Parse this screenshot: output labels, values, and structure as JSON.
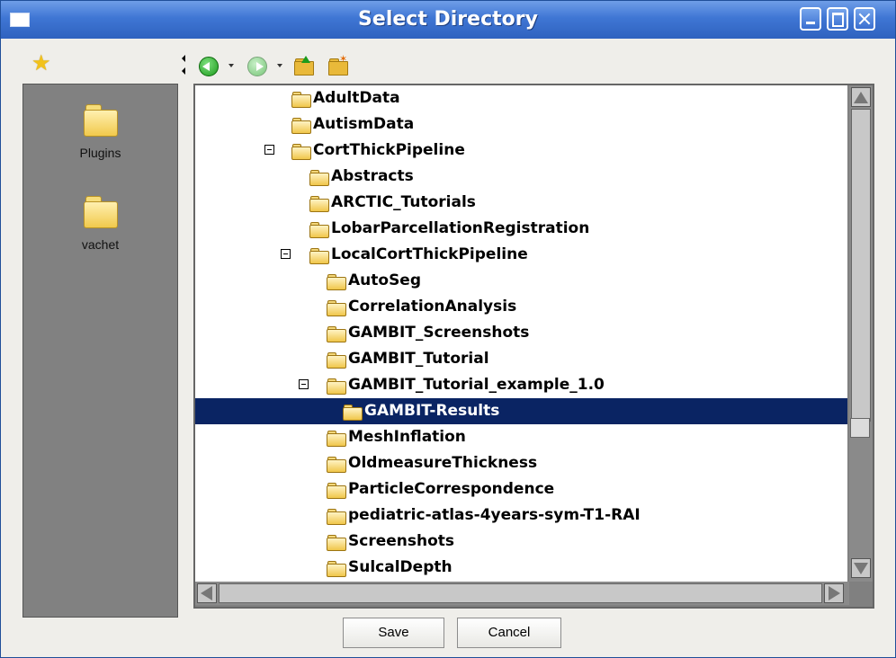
{
  "window": {
    "title": "Select Directory"
  },
  "toolbar": {
    "icons": [
      "star-icon",
      "back-arrow-icon",
      "forward-arrow-icon",
      "folder-up-icon",
      "new-folder-icon"
    ]
  },
  "bookmarks": {
    "items": [
      {
        "label": "Plugins",
        "icon": "folder-icon"
      },
      {
        "label": "vachet",
        "icon": "folder-icon"
      }
    ]
  },
  "tree": {
    "rows": [
      {
        "label": "AdultData",
        "depth": 0,
        "expanded": false,
        "selected": false
      },
      {
        "label": "AutismData",
        "depth": 0,
        "expanded": false,
        "selected": false
      },
      {
        "label": "CortThickPipeline",
        "depth": 0,
        "expanded": true,
        "selected": false
      },
      {
        "label": "Abstracts",
        "depth": 1,
        "expanded": false,
        "selected": false
      },
      {
        "label": "ARCTIC_Tutorials",
        "depth": 1,
        "expanded": false,
        "selected": false
      },
      {
        "label": "LobarParcellationRegistration",
        "depth": 1,
        "expanded": false,
        "selected": false
      },
      {
        "label": "LocalCortThickPipeline",
        "depth": 1,
        "expanded": true,
        "selected": false
      },
      {
        "label": "AutoSeg",
        "depth": 2,
        "expanded": false,
        "selected": false
      },
      {
        "label": "CorrelationAnalysis",
        "depth": 2,
        "expanded": false,
        "selected": false
      },
      {
        "label": "GAMBIT_Screenshots",
        "depth": 2,
        "expanded": false,
        "selected": false
      },
      {
        "label": "GAMBIT_Tutorial",
        "depth": 2,
        "expanded": false,
        "selected": false
      },
      {
        "label": "GAMBIT_Tutorial_example_1.0",
        "depth": 2,
        "expanded": true,
        "selected": false
      },
      {
        "label": "GAMBIT-Results",
        "depth": 3,
        "expanded": false,
        "selected": true
      },
      {
        "label": "MeshInflation",
        "depth": 2,
        "expanded": false,
        "selected": false
      },
      {
        "label": "OldmeasureThickness",
        "depth": 2,
        "expanded": false,
        "selected": false
      },
      {
        "label": "ParticleCorrespondence",
        "depth": 2,
        "expanded": false,
        "selected": false
      },
      {
        "label": "pediatric-atlas-4years-sym-T1-RAI",
        "depth": 2,
        "expanded": false,
        "selected": false
      },
      {
        "label": "Screenshots",
        "depth": 2,
        "expanded": false,
        "selected": false
      },
      {
        "label": "SulcalDepth",
        "depth": 2,
        "expanded": false,
        "selected": false
      }
    ]
  },
  "buttons": {
    "save": "Save",
    "cancel": "Cancel"
  }
}
